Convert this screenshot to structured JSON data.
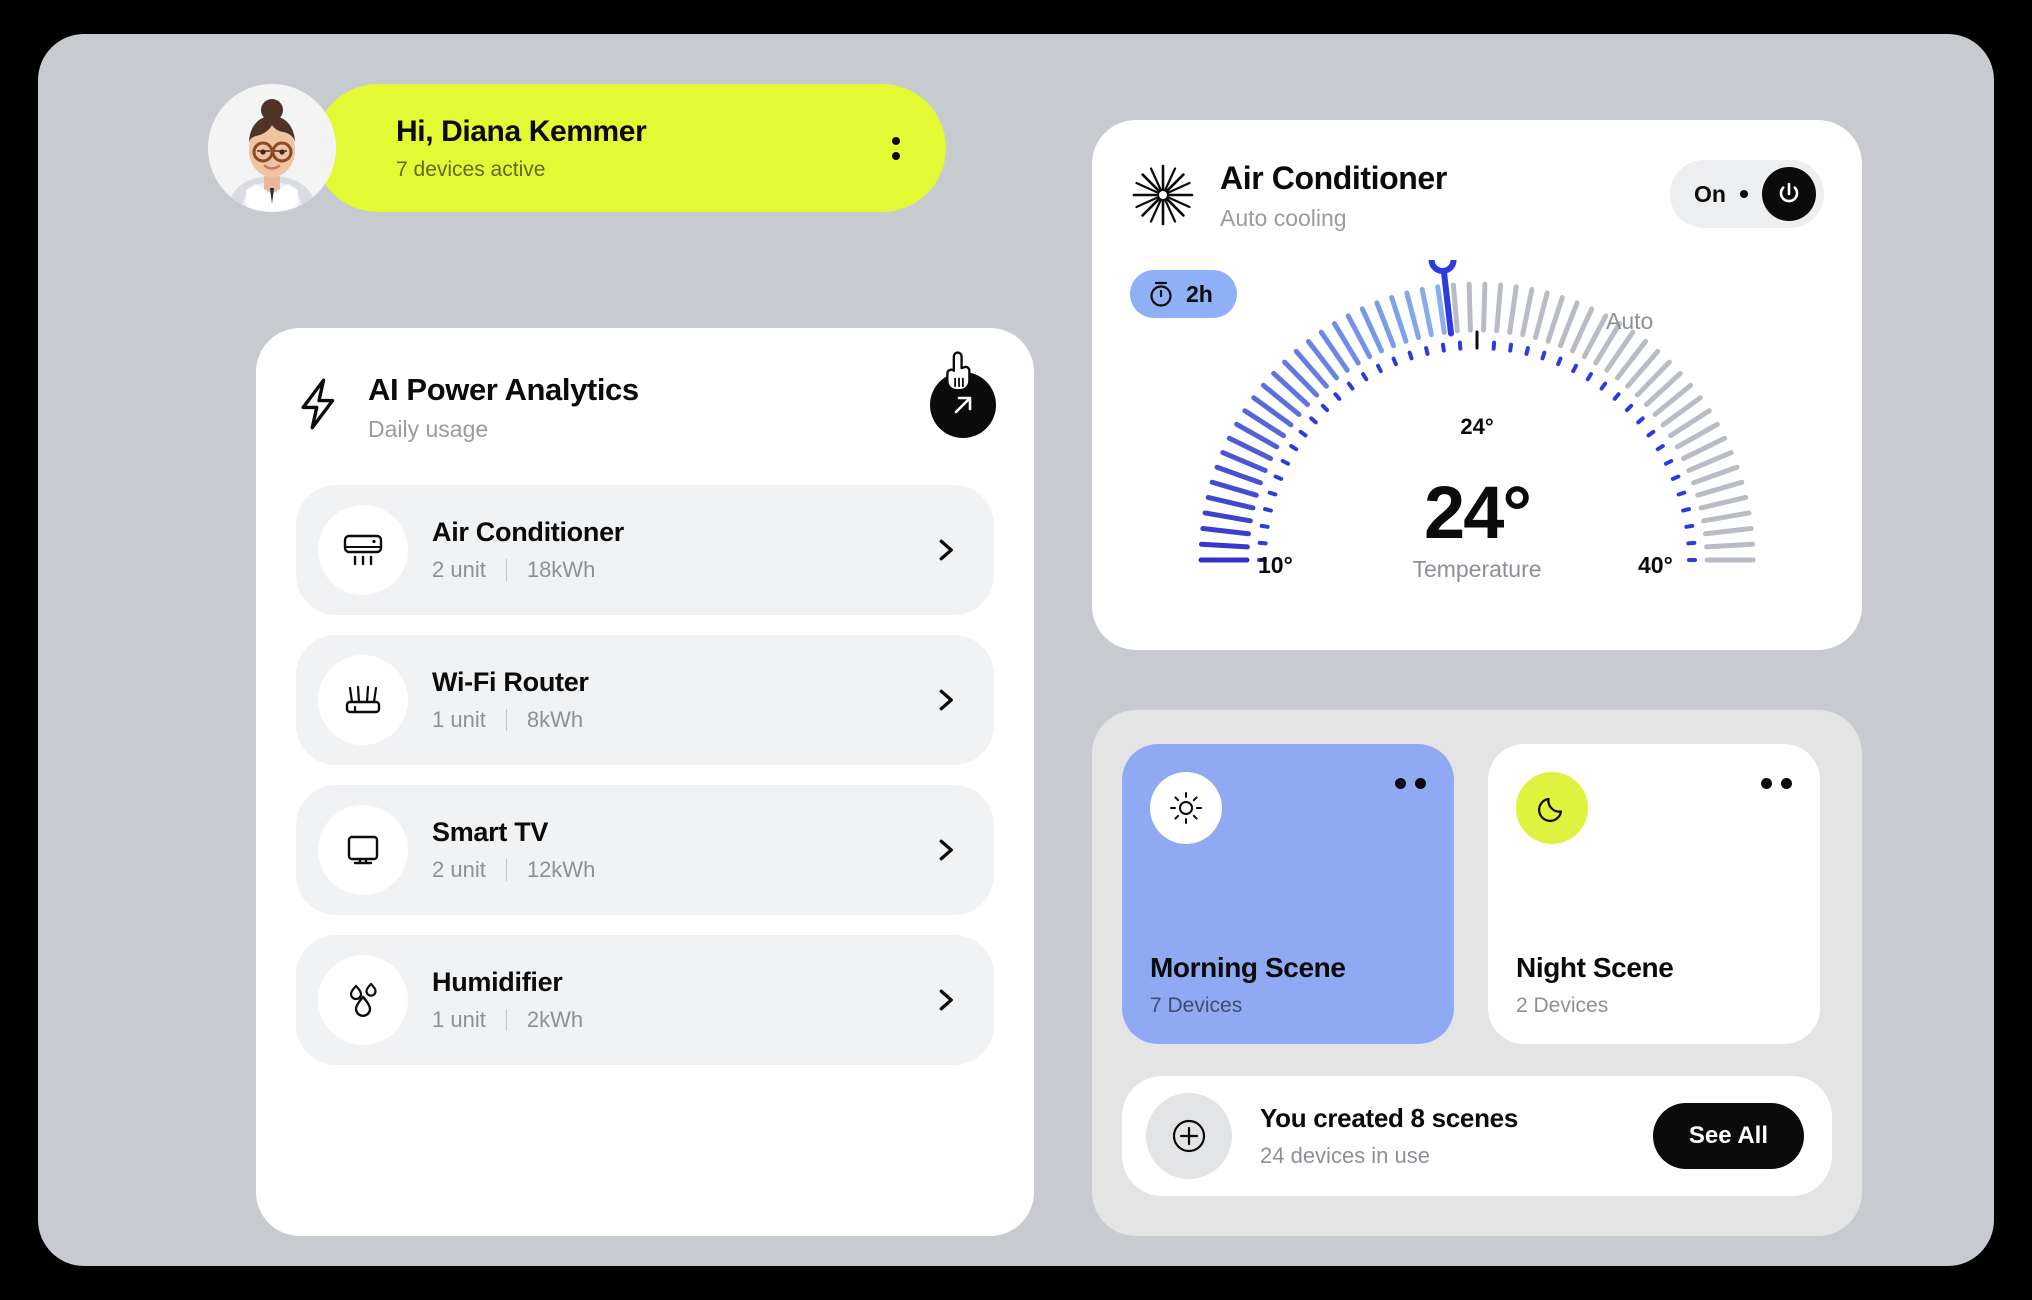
{
  "greeting": {
    "title": "Hi, Diana Kemmer",
    "subtitle": "7 devices active",
    "avatar_icon": "user-avatar",
    "menu_icon": "kebab-menu-icon"
  },
  "analytics": {
    "icon": "lightning-bolt-icon",
    "title": "AI Power Analytics",
    "subtitle": "Daily usage",
    "cta_icon": "arrow-up-right-icon",
    "cursor_icon": "pointing-hand-cursor",
    "devices": [
      {
        "icon": "air-conditioner-icon",
        "name": "Air Conditioner",
        "units": "2 unit",
        "energy": "18kWh",
        "chevron": "chevron-right-icon"
      },
      {
        "icon": "wifi-router-icon",
        "name": "Wi-Fi Router",
        "units": "1 unit",
        "energy": "8kWh",
        "chevron": "chevron-right-icon"
      },
      {
        "icon": "smart-tv-icon",
        "name": "Smart TV",
        "units": "2 unit",
        "energy": "12kWh",
        "chevron": "chevron-right-icon"
      },
      {
        "icon": "humidifier-icon",
        "name": "Humidifier",
        "units": "1 unit",
        "energy": "2kWh",
        "chevron": "chevron-right-icon"
      }
    ]
  },
  "air_conditioner": {
    "icon": "snowflake-icon",
    "title": "Air Conditioner",
    "subtitle": "Auto cooling",
    "power_state": "On",
    "power_icon": "power-icon",
    "timer": {
      "icon": "timer-icon",
      "label": "2h"
    },
    "gauge": {
      "handle_label": "Auto",
      "mid_label": "24°",
      "value": "24°",
      "caption": "Temperature",
      "min_label": "10°",
      "max_label": "40°"
    }
  },
  "scenes": {
    "cards": [
      {
        "icon": "sun-icon",
        "name": "Morning Scene",
        "devices": "7 Devices",
        "menu_icon": "two-dot-menu-icon"
      },
      {
        "icon": "moon-icon",
        "name": "Night Scene",
        "devices": "2 Devices",
        "menu_icon": "two-dot-menu-icon"
      }
    ],
    "create_bar": {
      "icon": "plus-circle-icon",
      "title": "You created 8 scenes",
      "subtitle": "24 devices in use",
      "button_label": "See All"
    }
  },
  "chart_data": {
    "type": "gauge",
    "title": "Temperature",
    "value": 24,
    "unit": "°",
    "min": 10,
    "max": 40,
    "mode": "Auto",
    "tick_count": 56,
    "active_ticks": 26,
    "colors": {
      "active_start": "#3333cc",
      "active_end": "#88b0ef",
      "inactive": "#b8bcc4",
      "handle": "#2c3ae0"
    }
  },
  "colors": {
    "page_background": "#000000",
    "panel": "#c7cbcf",
    "accent_lime": "#e3f933",
    "accent_blue": "#8fa9f3",
    "card_white": "#ffffff",
    "row_gray": "#f1f2f4",
    "ink": "#0b0b0b",
    "muted": "#8d9196"
  }
}
